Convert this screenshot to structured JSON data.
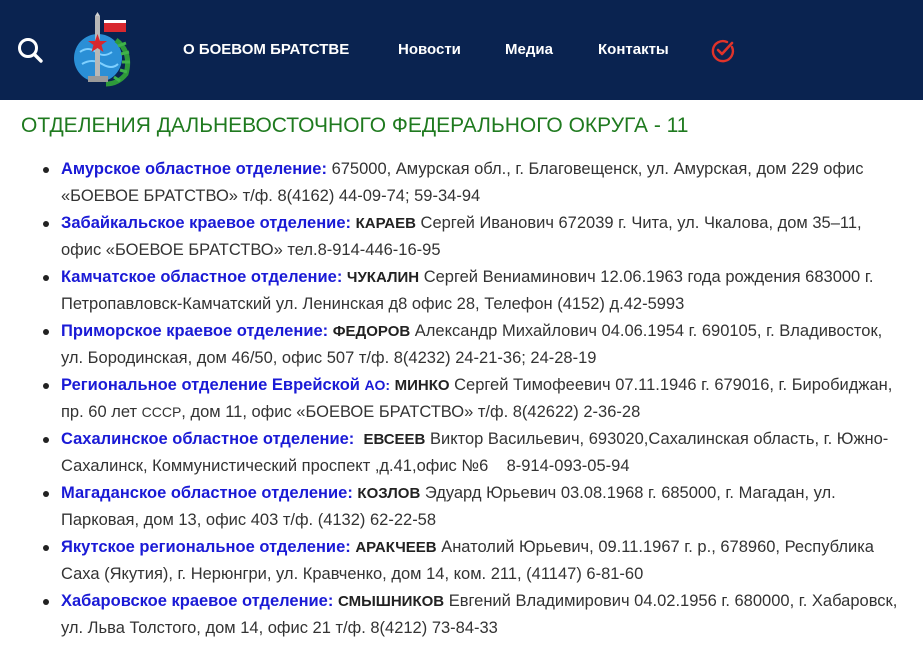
{
  "header": {
    "nav": [
      {
        "label": "О БОЕВОМ БРАТСТВЕ"
      },
      {
        "label": "Новости"
      },
      {
        "label": "Медиа"
      },
      {
        "label": "Контакты"
      }
    ],
    "colors": {
      "background": "#0a2350",
      "accent": "#e0332a"
    }
  },
  "main": {
    "heading": "ОТДЕЛЕНИЯ ДАЛЬНЕВОСТОЧНОГО ФЕДЕРАЛЬНОГО ОКРУГА - 11",
    "departments": [
      {
        "name": "Амурское областное отделение:",
        "head": "",
        "details": " 675000, Амурская обл., г. Благовещенск, ул. Амурская, дом 229 офис «БОЕВОЕ БРАТСТВО» т/ф. 8(4162) 44-09-74; 59-34-94"
      },
      {
        "name": "Забайкальское краевое отделение:",
        "head": "КАРАЕВ",
        "details": " Сергей Иванович 672039 г. Чита, ул. Чкалова, дом 35–11, офис «БОЕВОЕ БРАТСТВО» тел.8-914-446-16-95"
      },
      {
        "name": "Камчатское областное отделение:",
        "head": "ЧУКАЛИН",
        "details": " Сергей Вениаминович 12.06.1963 года рождения 683000 г. Петропавловск-Камчатский ул. Ленинская д8 офис 28, Телефон (4152) д.42-5993"
      },
      {
        "name": "Приморское краевое отделение:",
        "head": "ФЕДОРОВ",
        "details": " Александр Михайлович 04.06.1954 г. 690105, г. Владивосток, ул. Бородинская, дом 46/50, офис 507 т/ф. 8(4232) 24-21-36; 24-28-19"
      },
      {
        "name": "Региональное отделение Еврейской",
        "name_suffix": "АО:",
        "head": "МИНКО",
        "details_pre": " Сергей Тимофеевич 07.11.1946 г. 679016, г. Биробиджан, пр. 60 лет ",
        "details_small": "СССР",
        "details_post": ", дом 11, офис «БОЕВОЕ БРАТСТВО» т/ф. 8(42622) 2-36-28"
      },
      {
        "name": "Сахалинское областное отделение:",
        "head": "ЕВСЕЕВ",
        "details": " Виктор Васильевич, 693020,Сахалинская область, г. Южно-Сахалинск, Коммунистический проспект ,д.41,офис №6    8-914-093-05-94"
      },
      {
        "name": "Магаданское областное отделение:",
        "head": "КОЗЛОВ",
        "details": " Эдуард Юрьевич 03.08.1968 г. 685000, г. Магадан, ул. Парковая, дом 13, офис 403 т/ф. (4132) 62-22-58"
      },
      {
        "name": "Якутское региональное отделение:",
        "head": "АРАКЧЕЕВ",
        "details": " Анатолий Юрьевич, 09.11.1967 г. р., 678960, Республика Саха (Якутия), г. Нерюнгри, ул. Кравченко, дом 14, ком. 211, (41147) 6-81-60"
      },
      {
        "name": "Хабаровское краевое отделение:",
        "head": "СМЫШНИКОВ",
        "details": " Евгений Владимирович 04.02.1956 г. 680000, г. Хабаровск, ул. Льва Толстого, дом 14, офис 21 т/ф. 8(4212) 73-84-33"
      }
    ]
  }
}
